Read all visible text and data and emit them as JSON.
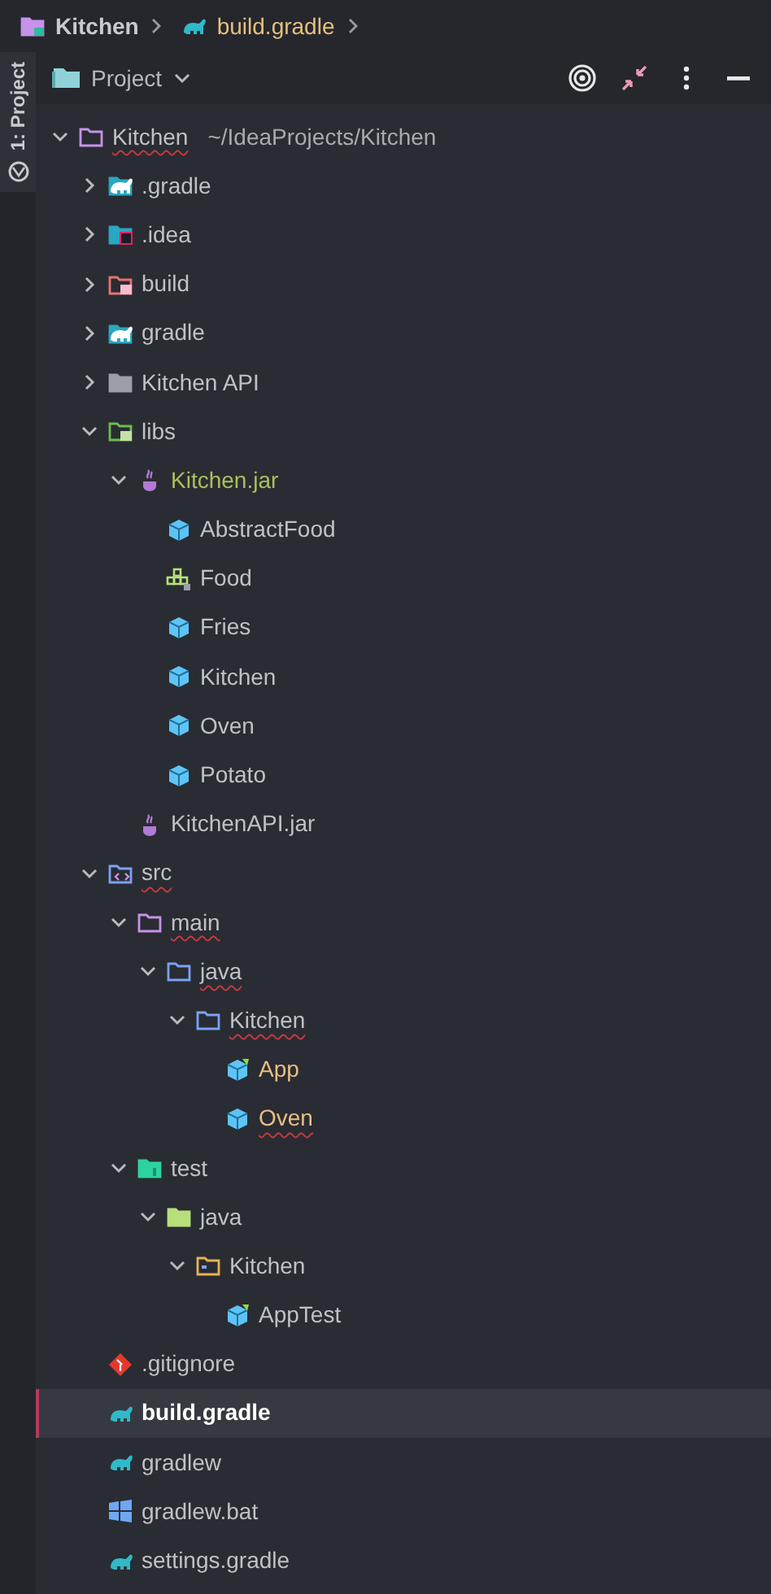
{
  "breadcrumbs": [
    {
      "label": "Kitchen",
      "kind": "module"
    },
    {
      "label": "build.gradle",
      "kind": "gradle"
    }
  ],
  "tool_strip": {
    "tab": "1: Project",
    "selected": true
  },
  "panel": {
    "title": "Project"
  },
  "tree": [
    {
      "label": "Kitchen",
      "hint": "~/IdeaProjects/Kitchen",
      "kind": "module-folder",
      "expanded": true,
      "error": true,
      "selected": false,
      "children": [
        {
          "label": ".gradle",
          "kind": "gradle-folder",
          "expanded": false,
          "error": false,
          "selected": false
        },
        {
          "label": ".idea",
          "kind": "idea-folder",
          "expanded": false,
          "error": false,
          "selected": false
        },
        {
          "label": "build",
          "kind": "build-folder",
          "expanded": false,
          "error": false,
          "selected": false
        },
        {
          "label": "gradle",
          "kind": "gradle-folder",
          "expanded": false,
          "error": false,
          "selected": false
        },
        {
          "label": "Kitchen API",
          "kind": "folder",
          "expanded": false,
          "error": false,
          "selected": false
        },
        {
          "label": "libs",
          "kind": "libs-folder",
          "expanded": true,
          "error": false,
          "selected": false,
          "children": [
            {
              "label": "Kitchen.jar",
              "kind": "jar",
              "color": "#a5c25c",
              "expanded": true,
              "error": false,
              "selected": false,
              "children": [
                {
                  "label": "AbstractFood",
                  "kind": "class",
                  "error": false,
                  "selected": false
                },
                {
                  "label": "Food",
                  "kind": "interface",
                  "error": false,
                  "selected": false
                },
                {
                  "label": "Fries",
                  "kind": "class",
                  "error": false,
                  "selected": false
                },
                {
                  "label": "Kitchen",
                  "kind": "class",
                  "error": false,
                  "selected": false
                },
                {
                  "label": "Oven",
                  "kind": "class",
                  "error": false,
                  "selected": false
                },
                {
                  "label": "Potato",
                  "kind": "class",
                  "error": false,
                  "selected": false
                }
              ]
            },
            {
              "label": "KitchenAPI.jar",
              "kind": "jar",
              "error": false,
              "selected": false
            }
          ]
        },
        {
          "label": "src",
          "kind": "src-folder",
          "expanded": true,
          "error": true,
          "selected": false,
          "children": [
            {
              "label": "main",
              "kind": "module-folder",
              "expanded": true,
              "error": true,
              "selected": false,
              "children": [
                {
                  "label": "java",
                  "kind": "source-folder",
                  "expanded": true,
                  "error": true,
                  "selected": false,
                  "children": [
                    {
                      "label": "Kitchen",
                      "kind": "source-folder",
                      "expanded": true,
                      "error": true,
                      "selected": false,
                      "children": [
                        {
                          "label": "App",
                          "kind": "main-class",
                          "color": "#e8bf82",
                          "error": false,
                          "selected": false
                        },
                        {
                          "label": "Oven",
                          "kind": "class",
                          "color": "#e8bf82",
                          "error": true,
                          "selected": false
                        }
                      ]
                    }
                  ]
                }
              ]
            },
            {
              "label": "test",
              "kind": "test-folder",
              "expanded": true,
              "error": false,
              "selected": false,
              "children": [
                {
                  "label": "java",
                  "kind": "test-root",
                  "expanded": true,
                  "error": false,
                  "selected": false,
                  "children": [
                    {
                      "label": "Kitchen",
                      "kind": "package",
                      "expanded": true,
                      "error": false,
                      "selected": false,
                      "children": [
                        {
                          "label": "AppTest",
                          "kind": "main-class",
                          "error": false,
                          "selected": false
                        }
                      ]
                    }
                  ]
                }
              ]
            }
          ]
        },
        {
          "label": ".gitignore",
          "kind": "git",
          "error": false,
          "selected": false
        },
        {
          "label": "build.gradle",
          "kind": "gradle",
          "error": false,
          "selected": true
        },
        {
          "label": "gradlew",
          "kind": "gradle",
          "error": false,
          "selected": false
        },
        {
          "label": "gradlew.bat",
          "kind": "windows",
          "error": false,
          "selected": false
        },
        {
          "label": "settings.gradle",
          "kind": "gradle",
          "error": false,
          "selected": false
        }
      ]
    }
  ]
}
